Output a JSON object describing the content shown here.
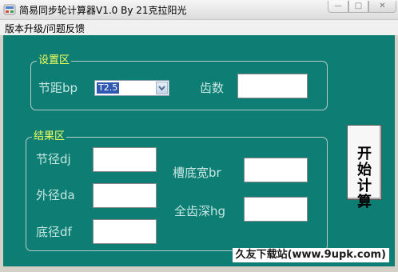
{
  "window": {
    "title": "简易同步轮计算器V1.0  By 21克拉阳光"
  },
  "menu": {
    "items": [
      {
        "label": "版本升级/问题反馈"
      }
    ]
  },
  "settings": {
    "group_label": "设置区",
    "pitch_label": "节距bp",
    "pitch_value": "T2.5",
    "teeth_label": "齿数",
    "teeth_value": ""
  },
  "results": {
    "group_label": "结果区",
    "pitch_diameter_label": "节径dj",
    "pitch_diameter_value": "",
    "outer_diameter_label": "外径da",
    "outer_diameter_value": "",
    "root_diameter_label": "底径df",
    "root_diameter_value": "",
    "groove_width_label": "槽底宽br",
    "groove_width_value": "",
    "tooth_depth_label": "全齿深hg",
    "tooth_depth_value": ""
  },
  "actions": {
    "start_label": "开始计算"
  },
  "watermark": "久友下载站(www.9upk.com)",
  "colors": {
    "client_bg": "#0e7e74",
    "group_label": "#f2ff5a",
    "label_text": "#c7e7e3"
  }
}
